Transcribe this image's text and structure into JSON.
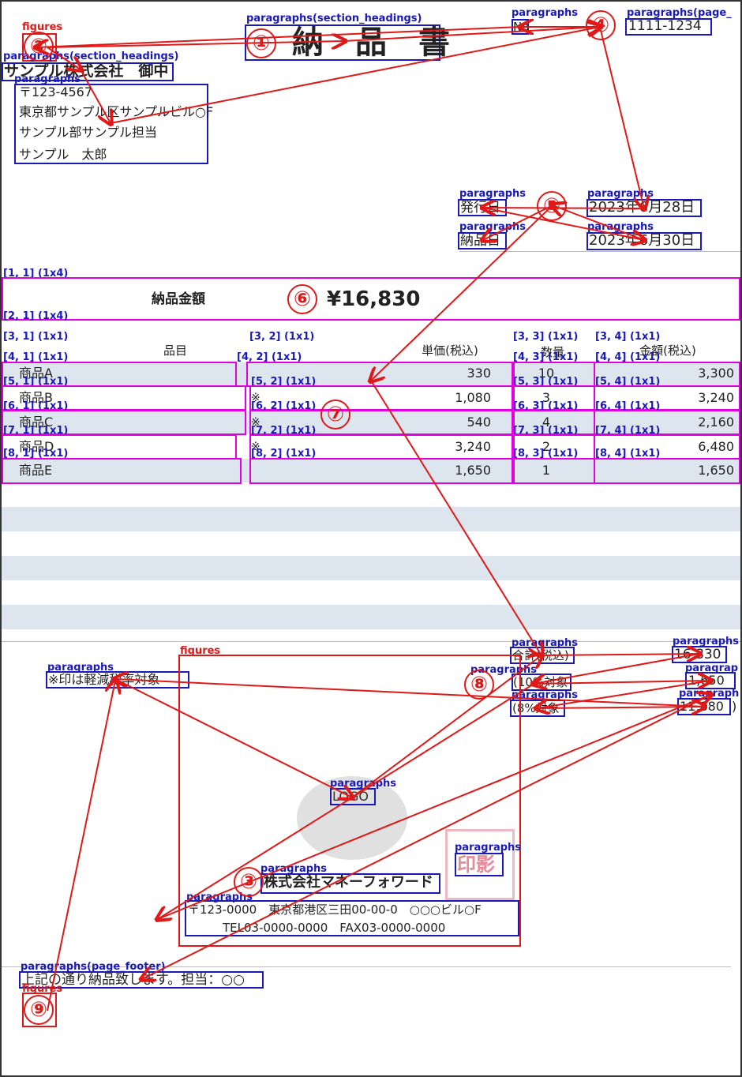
{
  "title": "納　品　書",
  "doc_no_label": "No",
  "doc_no": "1111-1234",
  "recipient": {
    "company": "サンプル株式会社　御中",
    "address_lines": [
      "〒123-4567",
      "東京都サンプル区サンプルビル○F",
      "サンプル部サンプル担当",
      "サンプル　太郎"
    ]
  },
  "dates": {
    "issue_label": "発行日",
    "issue_value": "2023年6月28日",
    "delivery_label": "納品日",
    "delivery_value": "2023年6月30日"
  },
  "amount": {
    "label": "納品金額",
    "value": "¥16,830"
  },
  "table": {
    "headers": [
      "品目",
      "単価(税込)",
      "数量",
      "金額(税込)"
    ],
    "rows": [
      {
        "item": "商品A",
        "mark": "",
        "price": "330",
        "qty": "10",
        "amount": "3,300"
      },
      {
        "item": "商品B",
        "mark": "※",
        "price": "1,080",
        "qty": "3",
        "amount": "3,240"
      },
      {
        "item": "商品C",
        "mark": "※",
        "price": "540",
        "qty": "4",
        "amount": "2,160"
      },
      {
        "item": "商品D",
        "mark": "※",
        "price": "3,240",
        "qty": "2",
        "amount": "6,480"
      },
      {
        "item": "商品E",
        "mark": "",
        "price": "1,650",
        "qty": "1",
        "amount": "1,650"
      }
    ]
  },
  "totals": {
    "total_label": "合計(税込)",
    "total_value": "16,830",
    "ten_label": "(10%対象",
    "ten_value": "1,650",
    "eight_label": "(8%対象",
    "eight_value": "11,880",
    "paren_close": ")"
  },
  "note": "※印は軽減税率対象",
  "sender": {
    "logo": "LOGO",
    "stamp": "印影",
    "company": "株式会社マネーフォワード",
    "address": "〒123-0000　東京都港区三田00-00-0　○○○ビル○F",
    "tel_fax": "TEL03-0000-0000　FAX03-0000-0000"
  },
  "footer": "上記の通り納品致します。担当：○○",
  "annotations": {
    "labels": {
      "figures": "figures",
      "paragraphs": "paragraphs",
      "section_headings": "paragraphs(section_headings)",
      "page_header": "paragraphs(page_",
      "page_footer": "paragraphs(page_footer)",
      "paragraphs_trunc": "paragraphs",
      "paragraphs_tiny": "paragrap",
      "paragraphs_tiny2": "paragraph"
    },
    "order_numbers": [
      "①",
      "②",
      "③",
      "④",
      "⑤",
      "⑥",
      "⑦",
      "⑧",
      "⑨"
    ],
    "cells": {
      "c11": "[1, 1] (1x4)",
      "c21": "[2, 1] (1x4)",
      "c31": "[3, 1] (1x1)",
      "c32": "[3, 2] (1x1)",
      "c33": "[3, 3] (1x1)",
      "c34": "[3, 4] (1x1)",
      "c41": "[4, 1] (1x1)",
      "c42": "[4, 2] (1x1)",
      "c43": "[4, 3] (1x1)",
      "c44": "[4, 4] (1x1)",
      "c51": "[5, 1] (1x1)",
      "c52": "[5, 2] (1x1)",
      "c53": "[5, 3] (1x1)",
      "c54": "[5, 4] (1x1)",
      "c61": "[6, 1] (1x1)",
      "c62": "[6, 2] (1x1)",
      "c63": "[6, 3] (1x1)",
      "c64": "[6, 4] (1x1)",
      "c71": "[7, 1] (1x1)",
      "c72": "[7, 2] (1x1)",
      "c73": "[7, 3] (1x1)",
      "c74": "[7, 4] (1x1)",
      "c81": "[8, 1] (1x1)",
      "c82": "[8, 2] (1x1)",
      "c83": "[8, 3] (1x1)",
      "c84": "[8, 4] (1x1)"
    }
  },
  "colors": {
    "box_blue": "#1a1ab8",
    "box_red": "#e01818",
    "box_magenta": "#e000e0",
    "row_shade": "#dde5ee"
  }
}
